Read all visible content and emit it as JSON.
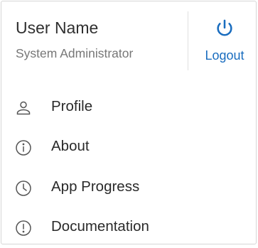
{
  "user": {
    "name": "User Name",
    "role": "System Administrator"
  },
  "logout": {
    "label": "Logout",
    "icon": "power-icon",
    "color": "#1a6dbf"
  },
  "menu": [
    {
      "label": "Profile",
      "icon": "person-icon"
    },
    {
      "label": "About",
      "icon": "info-icon"
    },
    {
      "label": "App Progress",
      "icon": "clock-icon"
    },
    {
      "label": "Documentation",
      "icon": "alert-icon"
    }
  ]
}
